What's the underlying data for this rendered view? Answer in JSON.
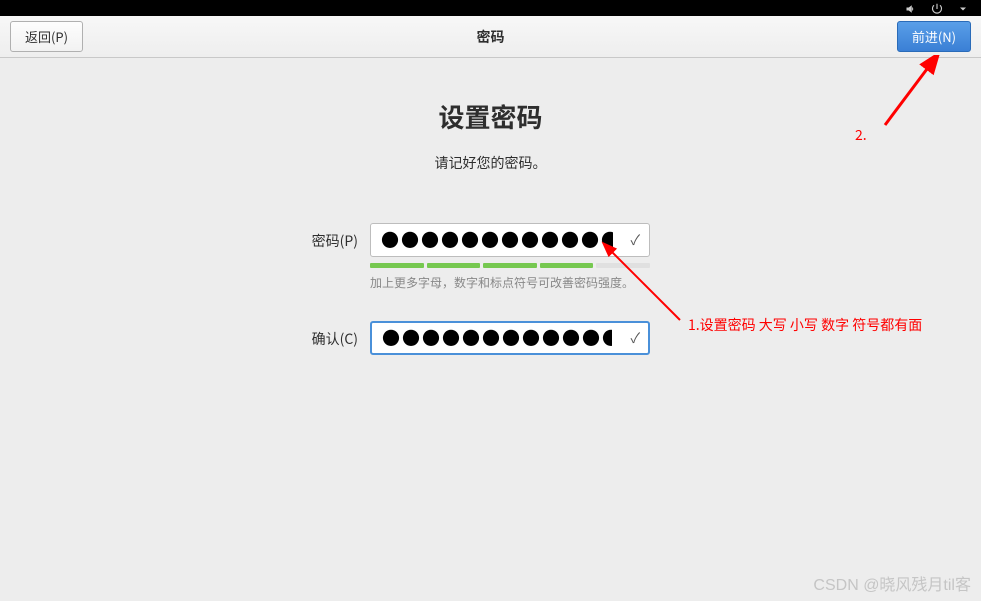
{
  "topbar": {
    "icons": [
      "volume-icon",
      "power-icon",
      "menu-icon"
    ]
  },
  "header": {
    "back_label": "返回(P)",
    "title": "密码",
    "forward_label": "前进(N)"
  },
  "content": {
    "main_title": "设置密码",
    "subtitle": "请记好您的密码。",
    "password_label": "密码(P)",
    "confirm_label": "确认(C)",
    "password_value": "●●●●●●●●●●●●●●",
    "confirm_value": "●●●●●●●●●●●●●●",
    "hint": "加上更多字母，数字和标点符号可改善密码强度。",
    "strength_filled": 4,
    "strength_total": 5
  },
  "annotations": {
    "label_1": "1.设置密码 大写 小写 数字 符号都有面",
    "label_2": "2."
  },
  "watermark": "CSDN @晓风残月til客"
}
